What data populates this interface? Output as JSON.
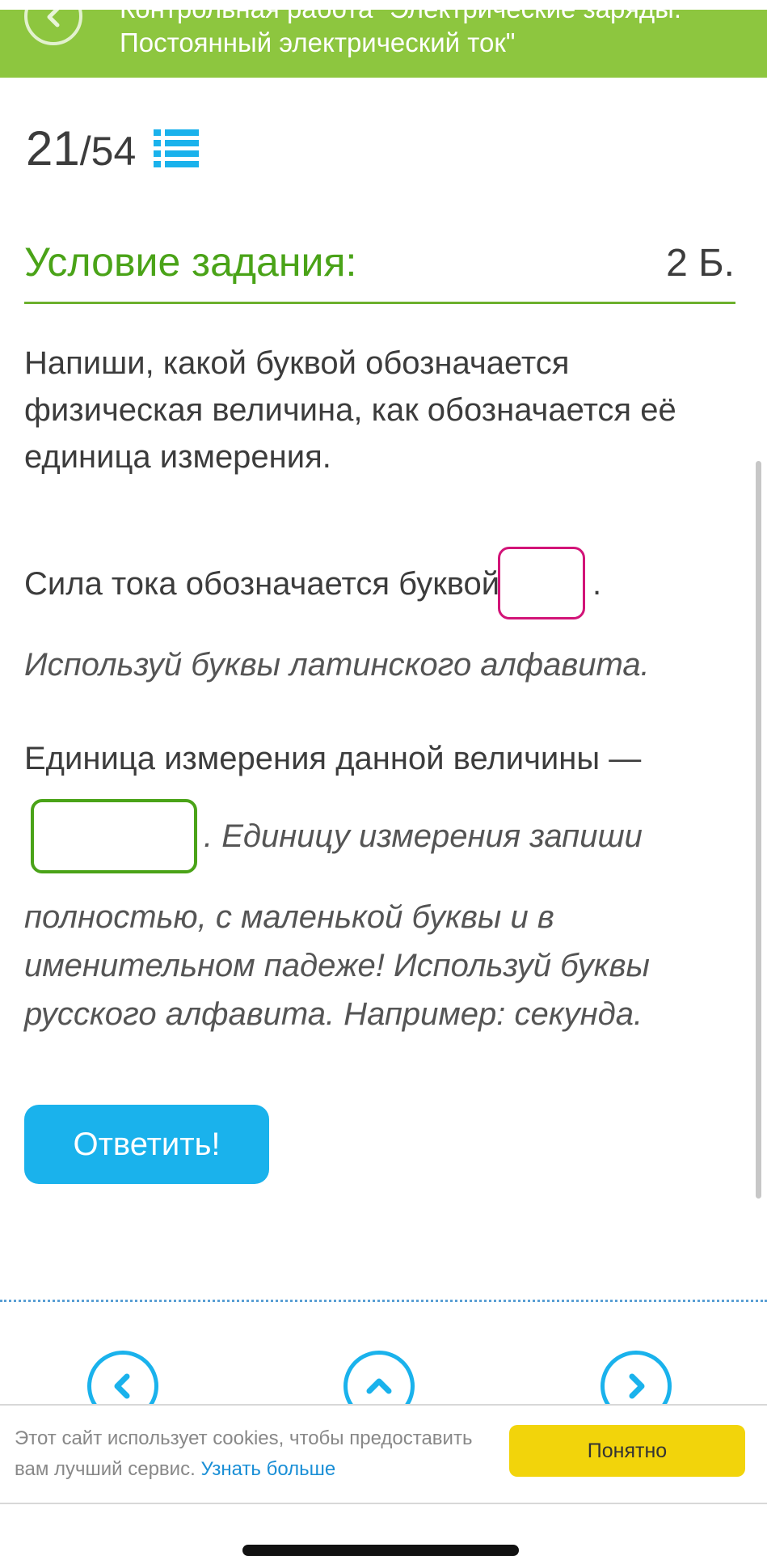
{
  "header": {
    "title_line1": "Контрольная работа \"Электрические заряды.",
    "title_line2": "Постоянный электрический ток\""
  },
  "progress": {
    "current": "21",
    "total": "/54"
  },
  "condition": {
    "title": "Условие задания:",
    "points": "2 Б."
  },
  "task": {
    "instruction": "Напиши, какой буквой обозначается физическая величина, как обозначается её единица измерения.",
    "line1_text": "Сила тока обозначается буквой",
    "line1_end": ".",
    "hint1": "Используй буквы латинского алфавита.",
    "line2_text": "Единица измерения данной величины —",
    "hint2_first": ". Единицу измерения запиши",
    "hint2_rest": "полностью, с маленькой буквы и в именительном падеже! Используй буквы русского алфавита. Например: секунда."
  },
  "answer_button": "Ответить!",
  "cookie": {
    "text": "Этот сайт использует cookies, чтобы предоставить вам лучший сервис.",
    "link": "Узнать больше",
    "button": "Понятно"
  },
  "colors": {
    "header_bg": "#8dc63f",
    "title_green": "#4aa318",
    "accent_blue": "#1ab2ec",
    "input_latin_border": "#d21478",
    "cookie_button": "#f2d40b"
  },
  "icons": {
    "back": "chevron-left-icon",
    "list": "list-icon",
    "prev": "chevron-left-icon",
    "up": "chevron-up-icon",
    "next": "chevron-right-icon"
  }
}
